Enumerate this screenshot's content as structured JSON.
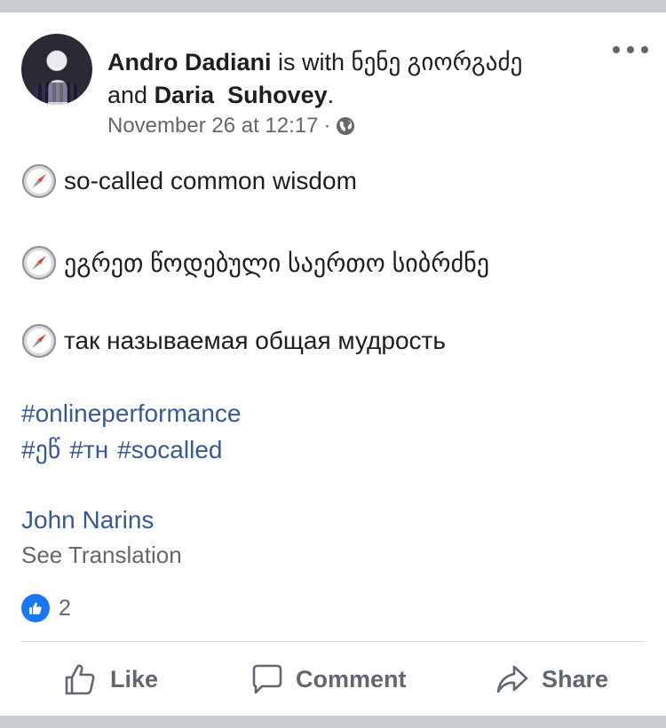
{
  "post": {
    "author": "Andro Dadiani",
    "with_text": " is with ",
    "tagged_1": "ნენე გიორგაძე",
    "and_text": "and ",
    "tagged_2": "Daria  Suhovey",
    "period": ".",
    "date": "November 26 at 12:17",
    "separator": "·",
    "privacy_icon": "globe-icon",
    "more_icon": "more-horizontal-icon",
    "lines": [
      "so-called common wisdom",
      "ეგრეთ წოდებული საერთო სიბრძნე",
      "так называемая общая мудрость"
    ],
    "line_icon": "compass-emoji",
    "hashtags_row1": [
      "#onlineperformance"
    ],
    "hashtags_row2": [
      "#ეწ",
      "#тн",
      "#socalled"
    ],
    "mention": "John Narins",
    "see_translation": "See Translation",
    "reaction_icon": "like-reaction-icon",
    "reaction_count": "2"
  },
  "actions": {
    "like": "Like",
    "comment": "Comment",
    "share": "Share"
  },
  "colors": {
    "link": "#385898",
    "meta_grey": "#65676b",
    "action_grey": "#606770",
    "like_blue": "#1877f2",
    "band": "#c9ccd1"
  }
}
